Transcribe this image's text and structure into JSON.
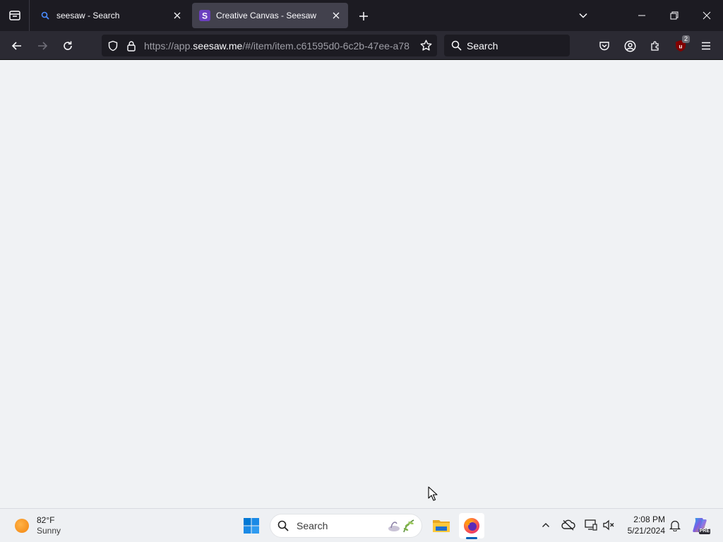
{
  "browser": {
    "tabs": [
      {
        "title": "seesaw - Search",
        "favicon": "search-favicon",
        "active": false
      },
      {
        "title": "Creative Canvas - Seesaw",
        "favicon": "seesaw-favicon",
        "active": true
      }
    ],
    "url_prefix": "https://app.",
    "url_host": "seesaw.me",
    "url_path": "/#/item/item.c61595d0-6c2b-47ee-a78",
    "search_placeholder": "Search",
    "extension_badge": "2"
  },
  "page": {
    "state": "blank"
  },
  "taskbar": {
    "weather_temp": "82°F",
    "weather_condition": "Sunny",
    "search_placeholder": "Search",
    "time": "2:08 PM",
    "date": "5/21/2024",
    "pinned_apps": [
      "file-explorer",
      "firefox"
    ],
    "copilot_label": "PRE"
  },
  "colors": {
    "tabstrip_bg": "#1c1b22",
    "navbar_bg": "#2b2a33",
    "active_tab_bg": "#42414d",
    "content_bg": "#f0f2f4",
    "taskbar_bg": "#eef0f3",
    "seesaw_purple": "#6b3fbf"
  }
}
